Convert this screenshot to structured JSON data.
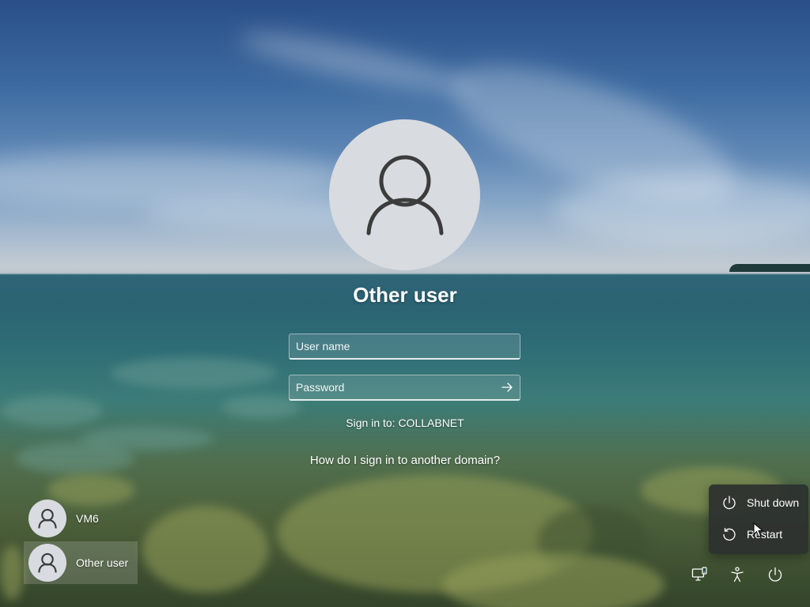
{
  "login": {
    "user_title": "Other user",
    "username_placeholder": "User name",
    "password_placeholder": "Password",
    "sign_in_to": "Sign in to: COLLABNET",
    "domain_link": "How do I sign in to another domain?"
  },
  "users": [
    {
      "name": "VM6",
      "icon": "person-icon"
    },
    {
      "name": "Other user",
      "icon": "person-icon",
      "selected": true
    }
  ],
  "power_menu": {
    "items": [
      {
        "label": "Shut down",
        "icon": "power-icon"
      },
      {
        "label": "Restart",
        "icon": "restart-icon"
      }
    ]
  },
  "system_tray": {
    "icons": [
      "network-icon",
      "accessibility-icon",
      "power-icon"
    ]
  },
  "colors": {
    "text": "#ffffff",
    "avatar_bg": "#d8dbdf",
    "avatar_glyph": "#3c3c3c",
    "menu_bg": "#2c302e"
  }
}
